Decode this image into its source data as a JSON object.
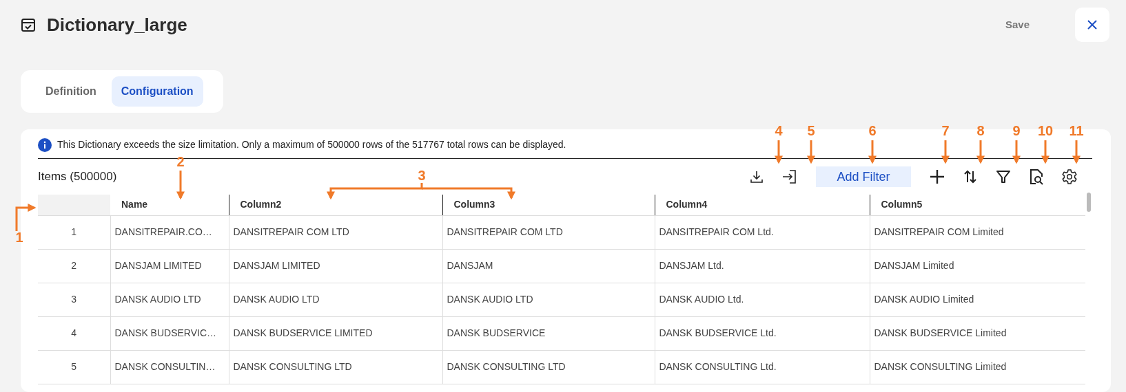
{
  "header": {
    "title": "Dictionary_large",
    "save": "Save"
  },
  "tabs": [
    {
      "label": "Definition",
      "selected": false
    },
    {
      "label": "Configuration",
      "selected": true
    }
  ],
  "notice": "This Dictionary exceeds the size limitation. Only a maximum of 500000 rows of the 517767 total rows can be displayed.",
  "items_label": "Items (500000)",
  "toolbar": [
    {
      "kind": "download"
    },
    {
      "kind": "import"
    },
    {
      "kind": "button",
      "label": "Add Filter"
    },
    {
      "kind": "add"
    },
    {
      "kind": "sort"
    },
    {
      "kind": "filter"
    },
    {
      "kind": "preview"
    },
    {
      "kind": "settings"
    }
  ],
  "table": {
    "columns": [
      "Name",
      "Column2",
      "Column3",
      "Column4",
      "Column5"
    ],
    "rows": [
      {
        "index": "1",
        "cells": [
          "DANSITREPAIR.CO…",
          "DANSITREPAIR COM LTD",
          "DANSITREPAIR COM LTD",
          "DANSITREPAIR COM Ltd.",
          "DANSITREPAIR COM Limited"
        ]
      },
      {
        "index": "2",
        "cells": [
          "DANSJAM LIMITED",
          "DANSJAM LIMITED",
          "DANSJAM",
          "DANSJAM Ltd.",
          "DANSJAM Limited"
        ]
      },
      {
        "index": "3",
        "cells": [
          "DANSK AUDIO LTD",
          "DANSK AUDIO LTD",
          "DANSK AUDIO LTD",
          "DANSK AUDIO Ltd.",
          "DANSK AUDIO Limited"
        ]
      },
      {
        "index": "4",
        "cells": [
          "DANSK BUDSERVIC…",
          "DANSK BUDSERVICE LIMITED",
          "DANSK BUDSERVICE",
          "DANSK BUDSERVICE Ltd.",
          "DANSK BUDSERVICE Limited"
        ]
      },
      {
        "index": "5",
        "cells": [
          "DANSK CONSULTIN…",
          "DANSK CONSULTING LTD",
          "DANSK CONSULTING LTD",
          "DANSK CONSULTING Ltd.",
          "DANSK CONSULTING Limited"
        ]
      }
    ]
  },
  "callouts": [
    {
      "label": "1"
    },
    {
      "label": "2"
    },
    {
      "label": "3"
    },
    {
      "label": "4"
    },
    {
      "label": "5"
    },
    {
      "label": "6"
    },
    {
      "label": "7"
    },
    {
      "label": "8"
    },
    {
      "label": "9"
    },
    {
      "label": "10"
    },
    {
      "label": "11"
    }
  ]
}
